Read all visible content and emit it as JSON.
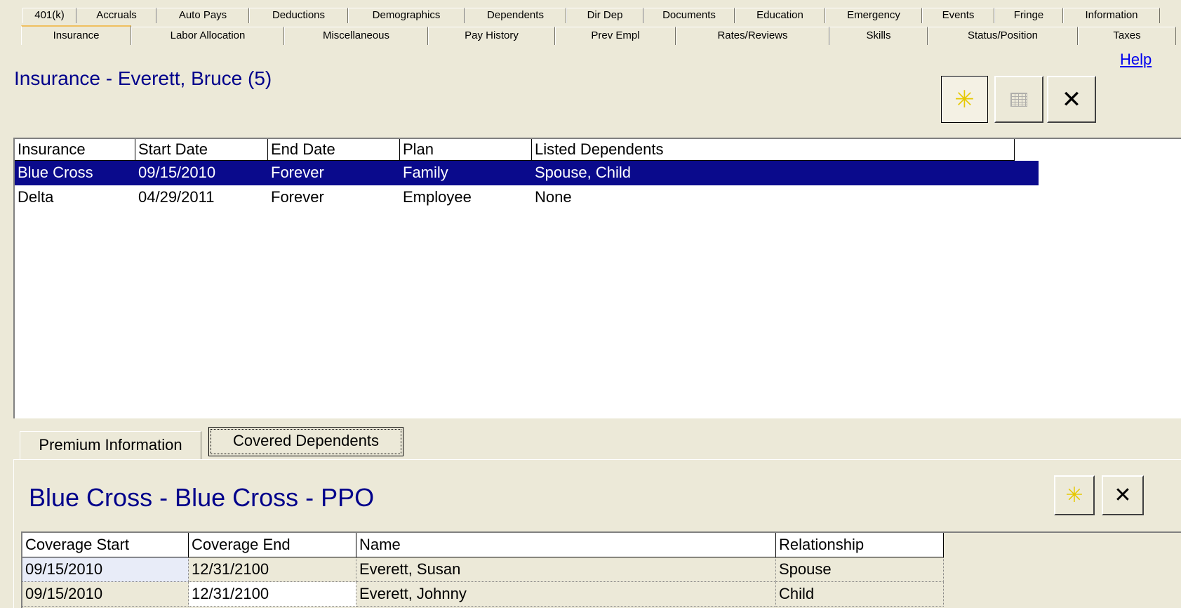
{
  "tabs_row1": [
    "401(k)",
    "Accruals",
    "Auto Pays",
    "Deductions",
    "Demographics",
    "Dependents",
    "Dir Dep",
    "Documents",
    "Education",
    "Emergency",
    "Events",
    "Fringe",
    "Information"
  ],
  "tabs_row2": [
    "Insurance",
    "Labor Allocation",
    "Miscellaneous",
    "Pay History",
    "Prev Empl",
    "Rates/Reviews",
    "Skills",
    "Status/Position",
    "Taxes"
  ],
  "active_tab": "Insurance",
  "help_label": "Help",
  "page_title": "Insurance - Everett, Bruce  (5)",
  "toolbar": {
    "new_icon": "asterisk-new-icon",
    "calendar_icon": "calendar-icon",
    "delete_icon": "x-close-icon"
  },
  "insurance_grid": {
    "columns": [
      "Insurance",
      "Start Date",
      "End Date",
      "Plan",
      "Listed Dependents"
    ],
    "rows": [
      [
        "Blue Cross",
        "09/15/2010",
        "Forever",
        "Family",
        "Spouse, Child"
      ],
      [
        "Delta",
        "04/29/2011",
        "Forever",
        "Employee",
        "None"
      ]
    ],
    "selected_row": 0
  },
  "sub_tabs": [
    "Premium Information",
    "Covered Dependents"
  ],
  "active_sub_tab": "Covered Dependents",
  "sub_title": "Blue Cross - Blue Cross - PPO",
  "dependents_grid": {
    "columns": [
      "Coverage Start",
      "Coverage End",
      "Name",
      "Relationship"
    ],
    "rows": [
      [
        "09/15/2010",
        "12/31/2100",
        "Everett, Susan",
        "Spouse"
      ],
      [
        "09/15/2010",
        "12/31/2100",
        "Everett, Johnny",
        "Child"
      ]
    ]
  },
  "colors": {
    "title": "#00008B",
    "selection": "#0A0A8C",
    "background": "#ECE9D8",
    "new_icon": "#E6C800"
  }
}
